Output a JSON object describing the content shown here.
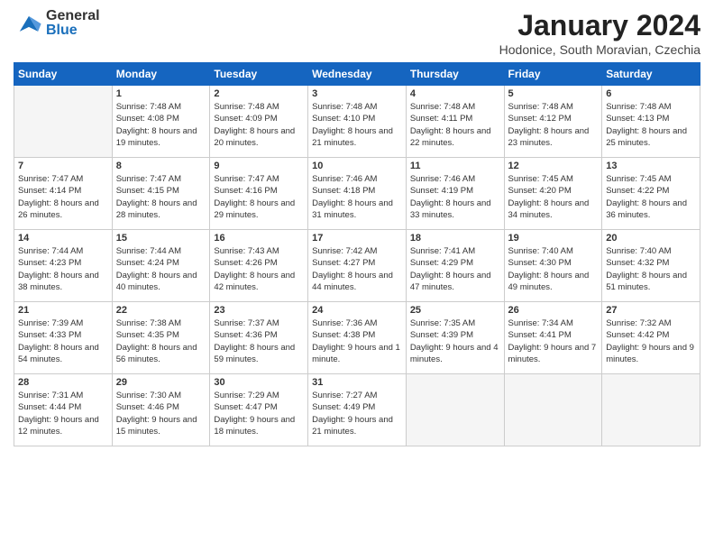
{
  "header": {
    "logo_general": "General",
    "logo_blue": "Blue",
    "month_title": "January 2024",
    "location": "Hodonice, South Moravian, Czechia"
  },
  "weekdays": [
    "Sunday",
    "Monday",
    "Tuesday",
    "Wednesday",
    "Thursday",
    "Friday",
    "Saturday"
  ],
  "weeks": [
    [
      {
        "day": "",
        "sunrise": "",
        "sunset": "",
        "daylight": ""
      },
      {
        "day": "1",
        "sunrise": "Sunrise: 7:48 AM",
        "sunset": "Sunset: 4:08 PM",
        "daylight": "Daylight: 8 hours and 19 minutes."
      },
      {
        "day": "2",
        "sunrise": "Sunrise: 7:48 AM",
        "sunset": "Sunset: 4:09 PM",
        "daylight": "Daylight: 8 hours and 20 minutes."
      },
      {
        "day": "3",
        "sunrise": "Sunrise: 7:48 AM",
        "sunset": "Sunset: 4:10 PM",
        "daylight": "Daylight: 8 hours and 21 minutes."
      },
      {
        "day": "4",
        "sunrise": "Sunrise: 7:48 AM",
        "sunset": "Sunset: 4:11 PM",
        "daylight": "Daylight: 8 hours and 22 minutes."
      },
      {
        "day": "5",
        "sunrise": "Sunrise: 7:48 AM",
        "sunset": "Sunset: 4:12 PM",
        "daylight": "Daylight: 8 hours and 23 minutes."
      },
      {
        "day": "6",
        "sunrise": "Sunrise: 7:48 AM",
        "sunset": "Sunset: 4:13 PM",
        "daylight": "Daylight: 8 hours and 25 minutes."
      }
    ],
    [
      {
        "day": "7",
        "sunrise": "Sunrise: 7:47 AM",
        "sunset": "Sunset: 4:14 PM",
        "daylight": "Daylight: 8 hours and 26 minutes."
      },
      {
        "day": "8",
        "sunrise": "Sunrise: 7:47 AM",
        "sunset": "Sunset: 4:15 PM",
        "daylight": "Daylight: 8 hours and 28 minutes."
      },
      {
        "day": "9",
        "sunrise": "Sunrise: 7:47 AM",
        "sunset": "Sunset: 4:16 PM",
        "daylight": "Daylight: 8 hours and 29 minutes."
      },
      {
        "day": "10",
        "sunrise": "Sunrise: 7:46 AM",
        "sunset": "Sunset: 4:18 PM",
        "daylight": "Daylight: 8 hours and 31 minutes."
      },
      {
        "day": "11",
        "sunrise": "Sunrise: 7:46 AM",
        "sunset": "Sunset: 4:19 PM",
        "daylight": "Daylight: 8 hours and 33 minutes."
      },
      {
        "day": "12",
        "sunrise": "Sunrise: 7:45 AM",
        "sunset": "Sunset: 4:20 PM",
        "daylight": "Daylight: 8 hours and 34 minutes."
      },
      {
        "day": "13",
        "sunrise": "Sunrise: 7:45 AM",
        "sunset": "Sunset: 4:22 PM",
        "daylight": "Daylight: 8 hours and 36 minutes."
      }
    ],
    [
      {
        "day": "14",
        "sunrise": "Sunrise: 7:44 AM",
        "sunset": "Sunset: 4:23 PM",
        "daylight": "Daylight: 8 hours and 38 minutes."
      },
      {
        "day": "15",
        "sunrise": "Sunrise: 7:44 AM",
        "sunset": "Sunset: 4:24 PM",
        "daylight": "Daylight: 8 hours and 40 minutes."
      },
      {
        "day": "16",
        "sunrise": "Sunrise: 7:43 AM",
        "sunset": "Sunset: 4:26 PM",
        "daylight": "Daylight: 8 hours and 42 minutes."
      },
      {
        "day": "17",
        "sunrise": "Sunrise: 7:42 AM",
        "sunset": "Sunset: 4:27 PM",
        "daylight": "Daylight: 8 hours and 44 minutes."
      },
      {
        "day": "18",
        "sunrise": "Sunrise: 7:41 AM",
        "sunset": "Sunset: 4:29 PM",
        "daylight": "Daylight: 8 hours and 47 minutes."
      },
      {
        "day": "19",
        "sunrise": "Sunrise: 7:40 AM",
        "sunset": "Sunset: 4:30 PM",
        "daylight": "Daylight: 8 hours and 49 minutes."
      },
      {
        "day": "20",
        "sunrise": "Sunrise: 7:40 AM",
        "sunset": "Sunset: 4:32 PM",
        "daylight": "Daylight: 8 hours and 51 minutes."
      }
    ],
    [
      {
        "day": "21",
        "sunrise": "Sunrise: 7:39 AM",
        "sunset": "Sunset: 4:33 PM",
        "daylight": "Daylight: 8 hours and 54 minutes."
      },
      {
        "day": "22",
        "sunrise": "Sunrise: 7:38 AM",
        "sunset": "Sunset: 4:35 PM",
        "daylight": "Daylight: 8 hours and 56 minutes."
      },
      {
        "day": "23",
        "sunrise": "Sunrise: 7:37 AM",
        "sunset": "Sunset: 4:36 PM",
        "daylight": "Daylight: 8 hours and 59 minutes."
      },
      {
        "day": "24",
        "sunrise": "Sunrise: 7:36 AM",
        "sunset": "Sunset: 4:38 PM",
        "daylight": "Daylight: 9 hours and 1 minute."
      },
      {
        "day": "25",
        "sunrise": "Sunrise: 7:35 AM",
        "sunset": "Sunset: 4:39 PM",
        "daylight": "Daylight: 9 hours and 4 minutes."
      },
      {
        "day": "26",
        "sunrise": "Sunrise: 7:34 AM",
        "sunset": "Sunset: 4:41 PM",
        "daylight": "Daylight: 9 hours and 7 minutes."
      },
      {
        "day": "27",
        "sunrise": "Sunrise: 7:32 AM",
        "sunset": "Sunset: 4:42 PM",
        "daylight": "Daylight: 9 hours and 9 minutes."
      }
    ],
    [
      {
        "day": "28",
        "sunrise": "Sunrise: 7:31 AM",
        "sunset": "Sunset: 4:44 PM",
        "daylight": "Daylight: 9 hours and 12 minutes."
      },
      {
        "day": "29",
        "sunrise": "Sunrise: 7:30 AM",
        "sunset": "Sunset: 4:46 PM",
        "daylight": "Daylight: 9 hours and 15 minutes."
      },
      {
        "day": "30",
        "sunrise": "Sunrise: 7:29 AM",
        "sunset": "Sunset: 4:47 PM",
        "daylight": "Daylight: 9 hours and 18 minutes."
      },
      {
        "day": "31",
        "sunrise": "Sunrise: 7:27 AM",
        "sunset": "Sunset: 4:49 PM",
        "daylight": "Daylight: 9 hours and 21 minutes."
      },
      {
        "day": "",
        "sunrise": "",
        "sunset": "",
        "daylight": ""
      },
      {
        "day": "",
        "sunrise": "",
        "sunset": "",
        "daylight": ""
      },
      {
        "day": "",
        "sunrise": "",
        "sunset": "",
        "daylight": ""
      }
    ]
  ]
}
